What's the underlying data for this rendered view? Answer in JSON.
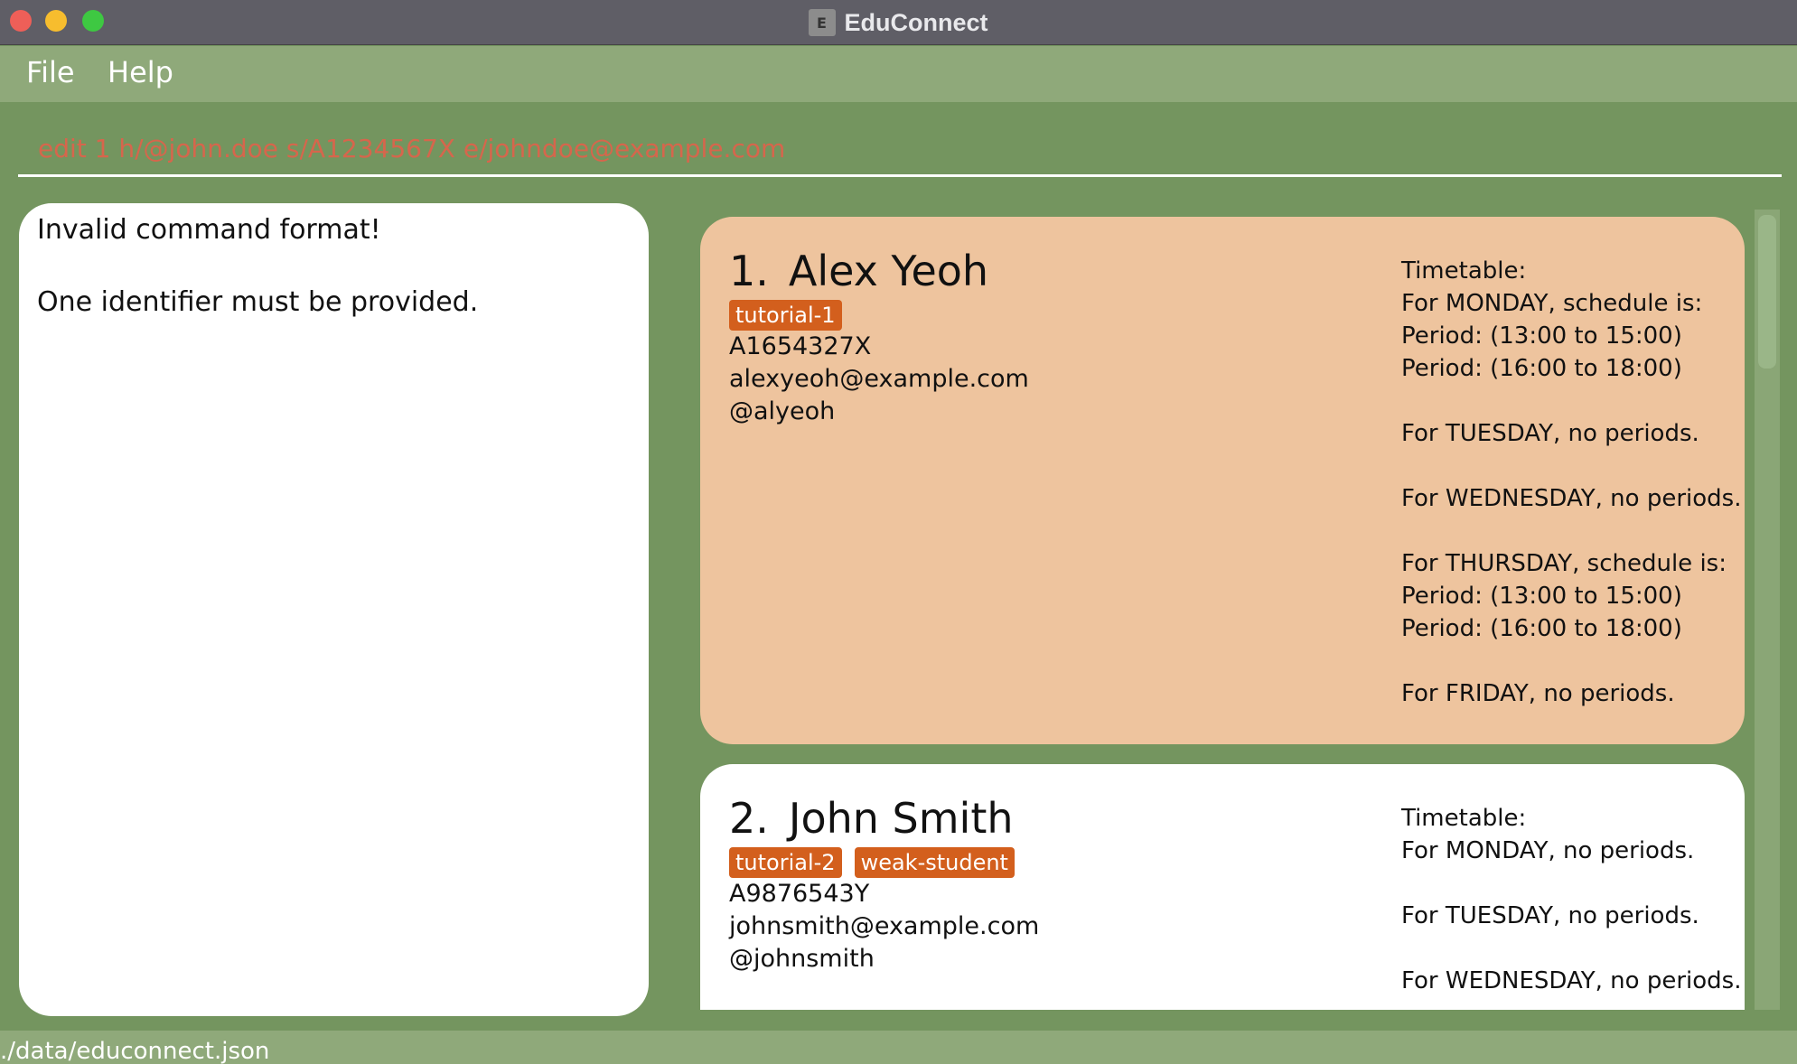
{
  "window": {
    "title": "EduConnect",
    "icon": "educonnect-app-icon",
    "icon_glyph": "E"
  },
  "menu": {
    "items": [
      "File",
      "Help"
    ]
  },
  "command": {
    "value": "edit 1 h/@john.doe s/A1234567X e/johndoe@example.com"
  },
  "result": {
    "lines": [
      "Invalid command format!",
      "",
      "One identifier must be provided."
    ]
  },
  "persons": [
    {
      "index": "1.",
      "name": "Alex Yeoh",
      "tags": [
        "tutorial-1"
      ],
      "student_id": "A1654327X",
      "email": "alexyeoh@example.com",
      "handle": "@alyeoh",
      "timetable": [
        "Timetable:",
        "For MONDAY, schedule is:",
        "Period: (13:00 to 15:00)",
        "Period: (16:00 to 18:00)",
        "",
        "For TUESDAY, no periods.",
        "",
        "For WEDNESDAY, no periods.",
        "",
        "For THURSDAY, schedule is:",
        "Period: (13:00 to 15:00)",
        "Period: (16:00 to 18:00)",
        "",
        "For FRIDAY, no periods."
      ]
    },
    {
      "index": "2.",
      "name": "John Smith",
      "tags": [
        "tutorial-2",
        "weak-student"
      ],
      "student_id": "A9876543Y",
      "email": "johnsmith@example.com",
      "handle": "@johnsmith",
      "timetable": [
        "Timetable:",
        "For MONDAY, no periods.",
        "",
        "For TUESDAY, no periods.",
        "",
        "For WEDNESDAY, no periods."
      ]
    }
  ],
  "status": {
    "file_path": "./data/educonnect.json"
  },
  "colors": {
    "background": "#74955f",
    "menubar": "#8fa97a",
    "selected_card": "#eec49e",
    "card": "#ffffff",
    "tag": "#d35f1d",
    "command_text": "#d6664c"
  }
}
